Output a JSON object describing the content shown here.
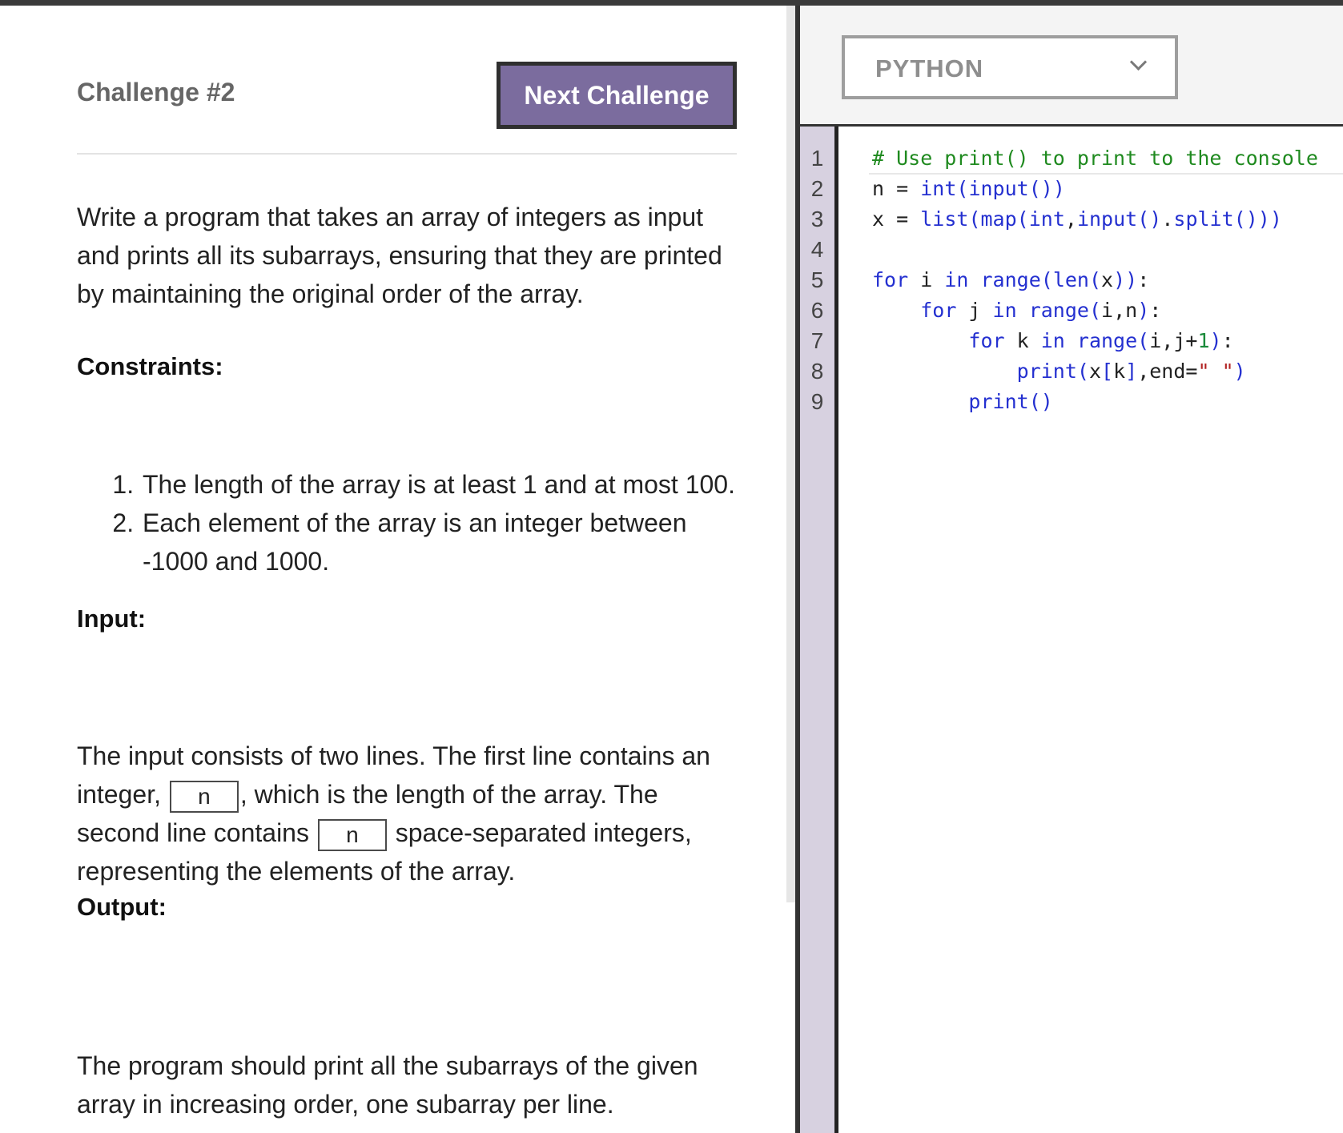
{
  "challenge": {
    "title": "Challenge #2",
    "next_button": "Next Challenge",
    "description": "Write a program that takes an array of integers as input and prints all its subarrays, ensuring that they are printed by maintaining the original order of the array.",
    "constraints_heading": "Constraints:",
    "constraints": [
      "The length of the array is at least 1 and at most 100.",
      "Each element of the array is an integer between -1000 and 1000."
    ],
    "input_heading": "Input:",
    "input_text": {
      "part1": "The input consists of two lines. The first line contains an integer, ",
      "var1": "n",
      "part2": ", which is the length of the array. The second line contains ",
      "var2": "n",
      "part3": " space-separated integers, representing the elements of the array."
    },
    "output_heading": "Output:",
    "output_text": "The program should print all the subarrays of the given array in increasing order, one subarray per line."
  },
  "editor": {
    "language": "PYTHON",
    "line_numbers": [
      "1",
      "2",
      "3",
      "4",
      "5",
      "6",
      "7",
      "8",
      "9"
    ],
    "code_lines": [
      "# Use print() to print to the console",
      "n = int(input())",
      "x = list(map(int,input().split()))",
      "",
      "for i in range(len(x)):",
      "    for j in range(i,n):",
      "        for k in range(i,j+1):",
      "            print(x[k],end=\" \")",
      "        print()"
    ]
  },
  "colors": {
    "button_bg": "#7b6c9e",
    "gutter_bg": "#d7d1e0",
    "comment": "#1f8a1f",
    "keyword": "#2430d0"
  }
}
